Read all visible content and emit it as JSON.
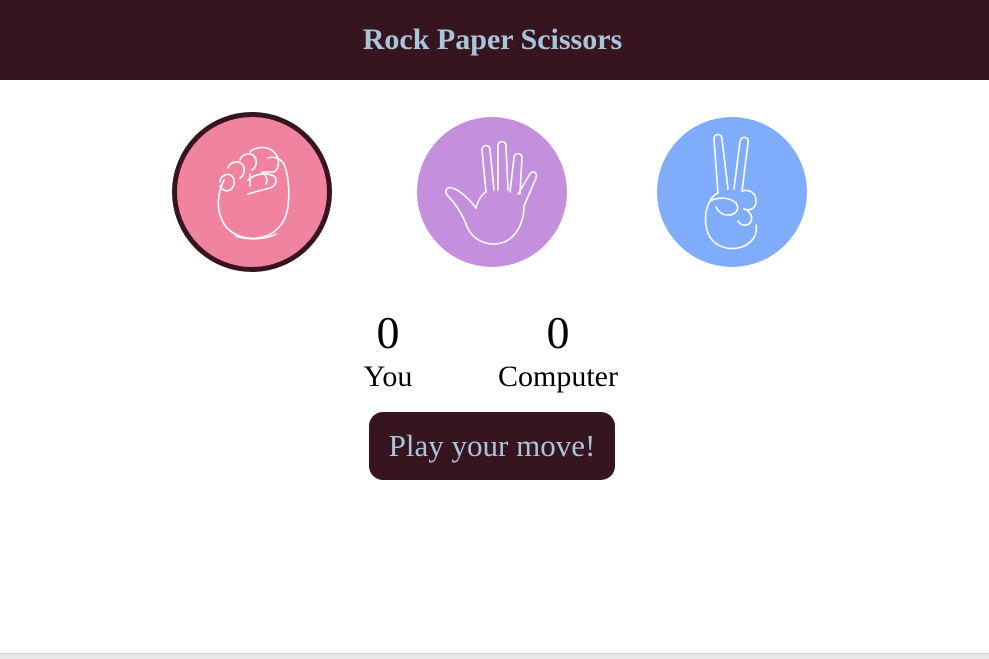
{
  "app": {
    "title": "Rock Paper Scissors"
  },
  "choices": [
    {
      "id": "rock",
      "icon": "fist-icon",
      "color": "#f0849f",
      "selected": true
    },
    {
      "id": "paper",
      "icon": "open-hand-icon",
      "color": "#c48fdc",
      "selected": false
    },
    {
      "id": "scissors",
      "icon": "peace-hand-icon",
      "color": "#80acfc",
      "selected": false
    }
  ],
  "scoreboard": {
    "you": {
      "score": "0",
      "label": "You"
    },
    "computer": {
      "score": "0",
      "label": "Computer"
    }
  },
  "play_button": {
    "label": "Play your move!"
  },
  "colors": {
    "header_bg": "#36151f",
    "header_text": "#a9c5dc",
    "selected_border": "#36151f"
  }
}
